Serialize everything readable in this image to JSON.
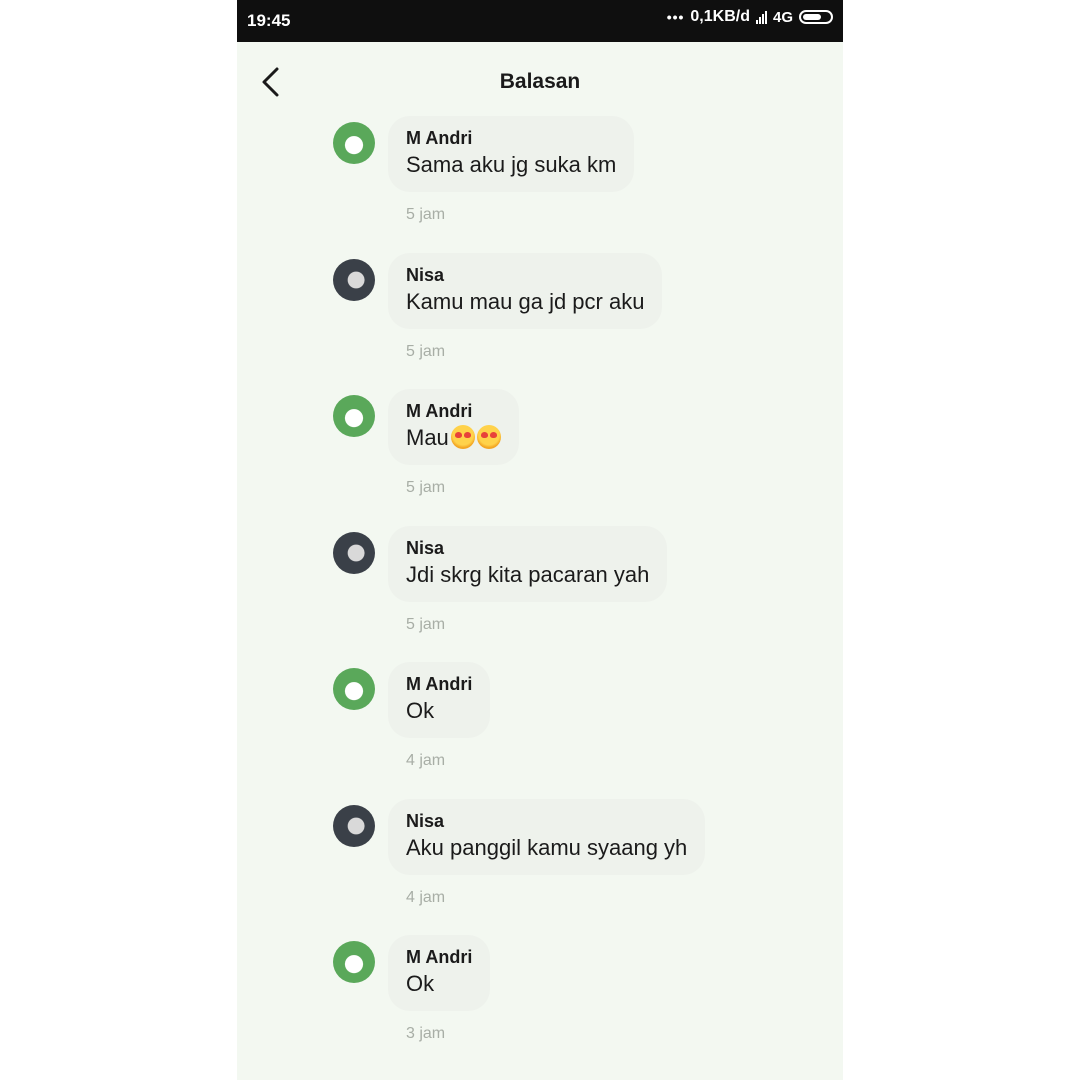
{
  "status_bar": {
    "time": "19:45",
    "dots": "•••",
    "net_speed": "0,1KB/d",
    "network": "4G"
  },
  "header": {
    "title": "Balasan",
    "back_icon": "chevron-left-icon"
  },
  "messages": [
    {
      "sender": "M Andri",
      "text": "Sama aku jg suka km",
      "time": "5 jam"
    },
    {
      "sender": "Nisa",
      "text": "Kamu mau ga jd pcr aku",
      "time": "5 jam"
    },
    {
      "sender": "M Andri",
      "text": "Mau",
      "emoji": "heart-eyes-emoji-icon",
      "time": "5 jam"
    },
    {
      "sender": "Nisa",
      "text": "Jdi skrg kita pacaran yah",
      "time": "5 jam"
    },
    {
      "sender": "M Andri",
      "text": "Ok",
      "time": "4 jam"
    },
    {
      "sender": "Nisa",
      "text": "Aku panggil kamu syaang yh",
      "time": "4 jam"
    },
    {
      "sender": "M Andri",
      "text": "Ok",
      "time": "3 jam"
    }
  ],
  "colors": {
    "background": "#f3f8f1",
    "bubble": "#eef2ec",
    "status_bar": "#0f0f0f",
    "timestamp": "#a8aea6"
  }
}
